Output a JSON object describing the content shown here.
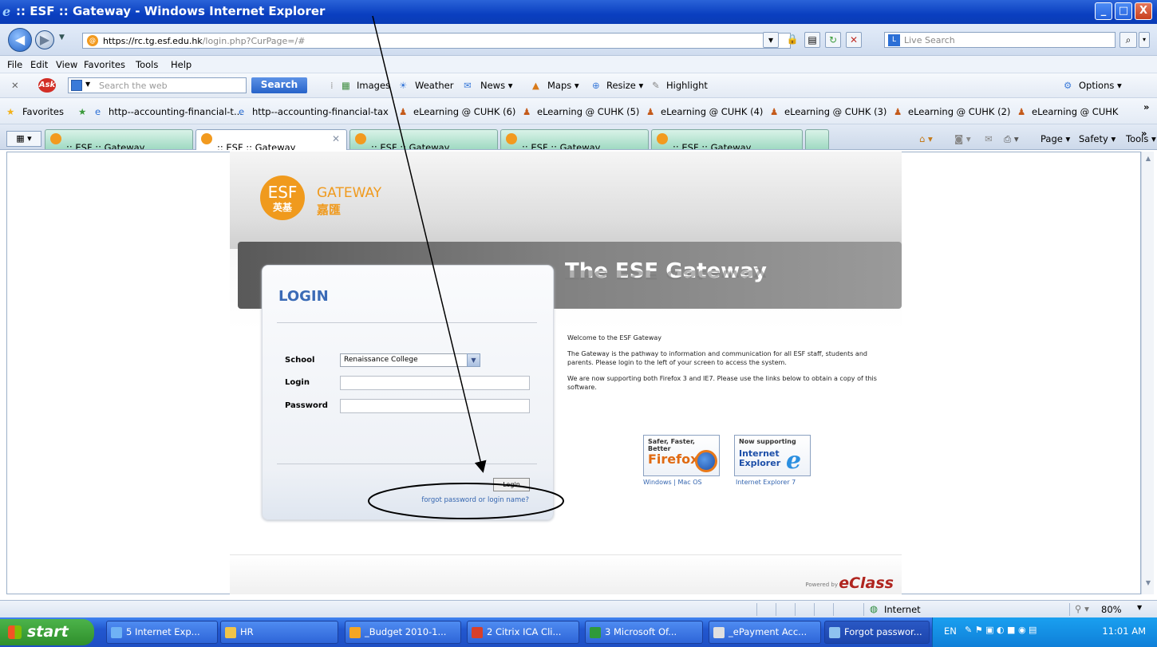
{
  "window": {
    "title": ":: ESF :: Gateway - Windows Internet Explorer",
    "controls": [
      "_",
      "□",
      "X"
    ]
  },
  "address": {
    "url_host": "https://rc.tg.esf.edu.hk",
    "url_path": "/login.php?CurPage=/#",
    "search_placeholder": "Live Search"
  },
  "menu": [
    "File",
    "Edit",
    "View",
    "Favorites",
    "Tools",
    "Help"
  ],
  "ask_toolbar": {
    "search_placeholder": "Search the web",
    "search_button": "Search",
    "items": [
      "Images",
      "Weather",
      "News ▾",
      "Maps ▾",
      "Resize ▾",
      "Highlight"
    ],
    "options": "Options ▾"
  },
  "favorites_bar": {
    "label": "Favorites",
    "items": [
      "http--accounting-financial-t...",
      "http--accounting-financial-tax",
      "eLearning @ CUHK (6)",
      "eLearning @ CUHK (5)",
      "eLearning @ CUHK (4)",
      "eLearning @ CUHK (3)",
      "eLearning @ CUHK (2)",
      "eLearning @ CUHK"
    ]
  },
  "tabs": [
    {
      "label": ":: ESF :: Gateway"
    },
    {
      "label": ":: ESF :: Gateway"
    },
    {
      "label": ":: ESF :: Gateway"
    },
    {
      "label": ":: ESF :: Gateway"
    },
    {
      "label": ":: ESF :: Gateway"
    }
  ],
  "command_bar": [
    "Page ▾",
    "Safety ▾",
    "Tools ▾"
  ],
  "page": {
    "logo_en": "ESF",
    "logo_cn": "英基",
    "gateway_en": "GATEWAY",
    "gateway_cn": "嘉匯",
    "banner_title": "The ESF Gateway",
    "login_heading": "LOGIN",
    "school_label": "School",
    "school_value": "Renaissance College",
    "login_label": "Login",
    "password_label": "Password",
    "login_button": "Login",
    "forgot_link": "forgot password or login name?",
    "welcome": [
      "Welcome to the ESF Gateway",
      "The Gateway is the pathway to information and communication for all ESF staff, students and parents. Please login to the left of your screen to access the system.",
      "We are now supporting both Firefox 3 and IE7. Please use the links below to obtain a copy of this software."
    ],
    "firefox_badge_top": "Safer, Faster, Better",
    "firefox_badge_name": "Firefox",
    "ie_badge_top": "Now supporting",
    "ie_badge_name": "Internet Explorer",
    "firefox_links": "Windows | Mac OS",
    "ie_link": "Internet Explorer 7",
    "powered_by": "Powered by",
    "eclass": "eClass"
  },
  "status": {
    "zone": "Internet",
    "zoom": "80%"
  },
  "taskbar": {
    "start": "start",
    "tasks": [
      "5 Internet Exp...",
      "HR",
      "_Budget 2010-1...",
      "2 Citrix ICA Cli...",
      "3 Microsoft Of...",
      "_ePayment Acc...",
      "Forgot passwor..."
    ],
    "lang": "EN",
    "clock": "11:01 AM"
  },
  "colors": {
    "esf_orange": "#f09a1d",
    "login_blue": "#3b6bb6",
    "link_blue": "#3566b0",
    "eclass_red": "#b0251f"
  }
}
